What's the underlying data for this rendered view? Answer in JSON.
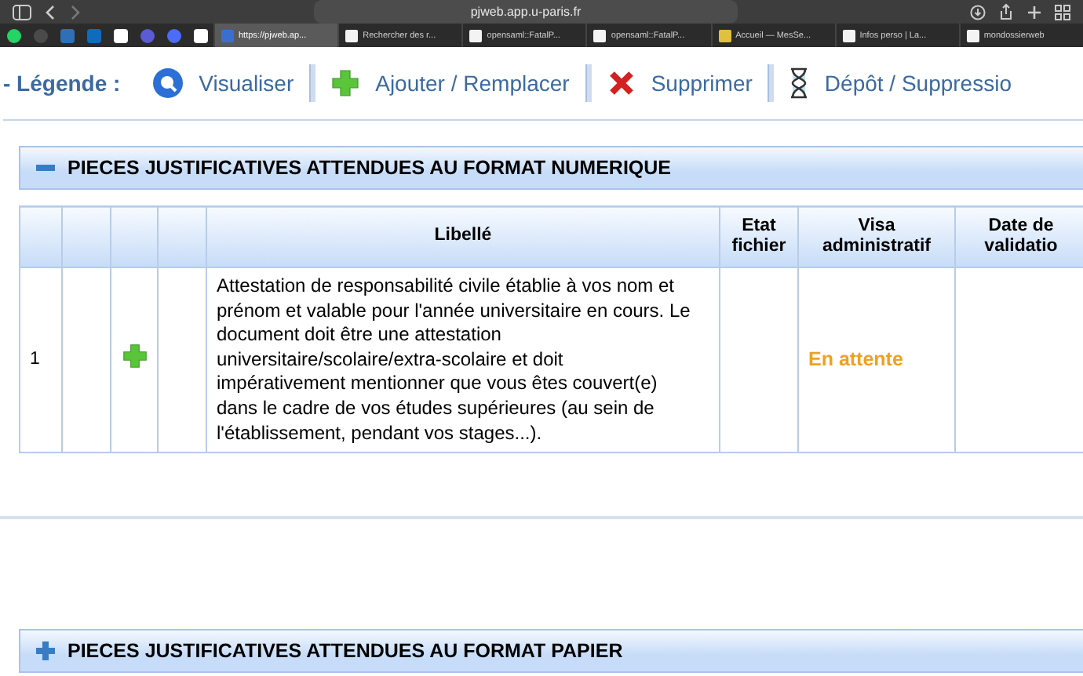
{
  "browser": {
    "address": "pjweb.app.u-paris.fr",
    "tabs": [
      {
        "title": "https://pjweb.ap...",
        "selected": true
      },
      {
        "title": "Rechercher des r...",
        "selected": false
      },
      {
        "title": "opensaml::FatalP...",
        "selected": false
      },
      {
        "title": "opensaml::FatalP...",
        "selected": false
      },
      {
        "title": "Accueil — MesSe...",
        "selected": false
      },
      {
        "title": "Infos perso | La...",
        "selected": false
      },
      {
        "title": "mondossierweb",
        "selected": false
      }
    ]
  },
  "legend": {
    "label": "- Légende :",
    "items": [
      {
        "kind": "view",
        "label": "Visualiser"
      },
      {
        "kind": "add",
        "label": "Ajouter / Remplacer"
      },
      {
        "kind": "delete",
        "label": "Supprimer"
      },
      {
        "kind": "pending",
        "label": "Dépôt / Suppressio"
      }
    ]
  },
  "sections": [
    {
      "title": "PIECES JUSTIFICATIVES ATTENDUES AU FORMAT NUMERIQUE",
      "expanded": true,
      "table": {
        "columns": [
          "",
          "",
          "",
          "",
          "Libellé",
          "Etat fichier",
          "Visa administratif",
          "Date de validatio"
        ],
        "rows": [
          {
            "number": "1",
            "label": "Attestation de responsabilité civile établie à vos nom et prénom et valable pour l'année universitaire en cours. Le document doit être une attestation universitaire/scolaire/extra-scolaire et doit impérativement mentionner que vous êtes couvert(e) dans le cadre de vos études supérieures (au sein de l'établissement, pendant vos stages...).",
            "visa": "En attente"
          }
        ]
      }
    },
    {
      "title": "PIECES JUSTIFICATIVES ATTENDUES AU FORMAT PAPIER",
      "expanded": false
    }
  ]
}
